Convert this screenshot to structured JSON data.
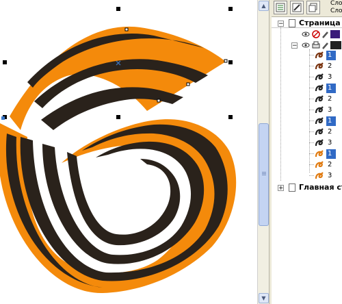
{
  "docker": {
    "toolbar_labels": [
      "Сло",
      "Сло"
    ],
    "tree": {
      "page1_toggle": "−",
      "page1_title": "Страница",
      "layer_toggle": "−",
      "objects": [
        {
          "label": "1",
          "selected": true,
          "color": "#7a3410"
        },
        {
          "label": "2",
          "selected": false,
          "color": "#7a3410"
        },
        {
          "label": "3",
          "selected": false,
          "color": "#222222"
        },
        {
          "label": "1",
          "selected": true,
          "color": "#222222"
        },
        {
          "label": "2",
          "selected": false,
          "color": "#222222"
        },
        {
          "label": "3",
          "selected": false,
          "color": "#222222"
        },
        {
          "label": "1",
          "selected": true,
          "color": "#222222"
        },
        {
          "label": "2",
          "selected": false,
          "color": "#222222"
        },
        {
          "label": "3",
          "selected": false,
          "color": "#222222"
        },
        {
          "label": "1",
          "selected": true,
          "color": "#e07a10"
        },
        {
          "label": "2",
          "selected": false,
          "color": "#e07a10"
        },
        {
          "label": "3",
          "selected": false,
          "color": "#e07a10"
        }
      ],
      "master_toggle": "+",
      "master_title": "Главная ст"
    }
  },
  "colors": {
    "orange": "#f48a0b",
    "black": "#2a221b",
    "outline": "#8fa0b0",
    "selection": "#316ac5",
    "page_swatch": "#3b1c7a"
  }
}
